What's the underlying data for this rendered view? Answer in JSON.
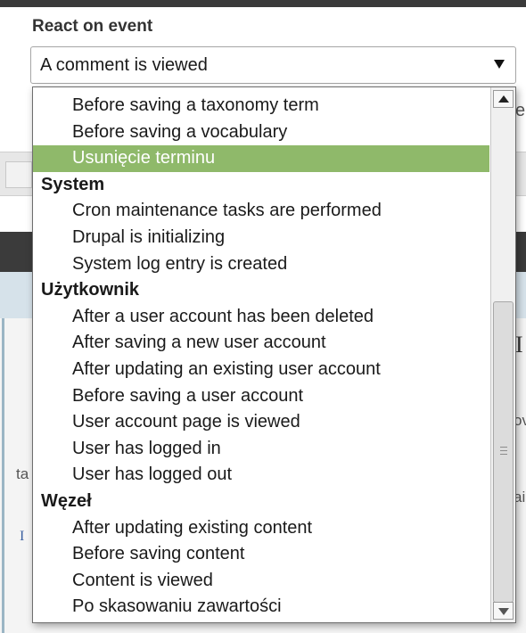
{
  "form": {
    "label": "React on event",
    "selected_value": "A comment is viewed"
  },
  "dropdown": {
    "options": [
      {
        "type": "child",
        "label": "Before saving a taxonomy term"
      },
      {
        "type": "child",
        "label": "Before saving a vocabulary"
      },
      {
        "type": "child",
        "label": "Usunięcie terminu",
        "selected": true
      },
      {
        "type": "group",
        "label": "System"
      },
      {
        "type": "child",
        "label": "Cron maintenance tasks are performed"
      },
      {
        "type": "child",
        "label": "Drupal is initializing"
      },
      {
        "type": "child",
        "label": "System log entry is created"
      },
      {
        "type": "group",
        "label": "Użytkownik"
      },
      {
        "type": "child",
        "label": "After a user account has been deleted"
      },
      {
        "type": "child",
        "label": "After saving a new user account"
      },
      {
        "type": "child",
        "label": "After updating an existing user account"
      },
      {
        "type": "child",
        "label": "Before saving a user account"
      },
      {
        "type": "child",
        "label": "User account page is viewed"
      },
      {
        "type": "child",
        "label": "User has logged in"
      },
      {
        "type": "child",
        "label": "User has logged out"
      },
      {
        "type": "group",
        "label": "Węzeł"
      },
      {
        "type": "child",
        "label": "After updating existing content"
      },
      {
        "type": "child",
        "label": "Before saving content"
      },
      {
        "type": "child",
        "label": "Content is viewed"
      },
      {
        "type": "child",
        "label": "Po skasowaniu zawartości"
      }
    ],
    "selected_color": "#8fb96a"
  },
  "background_fragments": {
    "right_top": "e",
    "right_heading": "I",
    "right_mid": "ov",
    "right_low": "ai",
    "left_mid": "ta",
    "left_link": "I"
  },
  "icons": {
    "select_arrow": "caret-down-icon",
    "scroll_up": "arrow-up-icon",
    "scroll_down": "arrow-down-icon",
    "scroll_grip": "grip-icon"
  }
}
